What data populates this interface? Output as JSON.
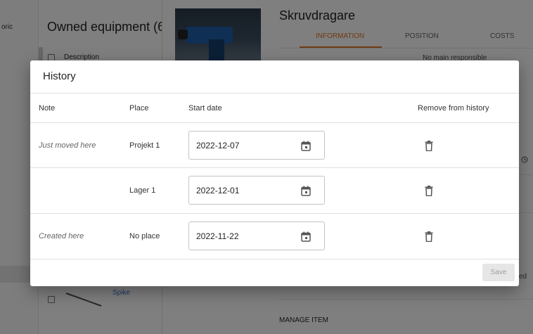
{
  "background": {
    "nav_fragment": "oric",
    "list_title": "Owned equipment (6",
    "list_header_description": "Description",
    "list_row_link": "Spike",
    "item_title": "Skruvdragare",
    "tabs": [
      {
        "label": "INFORMATION",
        "active": true
      },
      {
        "label": "POSITION",
        "active": false
      },
      {
        "label": "COSTS",
        "active": false
      }
    ],
    "responsible_text": "No main responsible",
    "edge_text": "ed",
    "section_manage": "MANAGE ITEM"
  },
  "dialog": {
    "title": "History",
    "columns": {
      "note": "Note",
      "place": "Place",
      "start_date": "Start date",
      "remove": "Remove from history"
    },
    "rows": [
      {
        "note": "Just moved here",
        "place": "Projekt 1",
        "start_date": "2022-12-07"
      },
      {
        "note": "",
        "place": "Lager 1",
        "start_date": "2022-12-01"
      },
      {
        "note": "Created here",
        "place": "No place",
        "start_date": "2022-11-22"
      }
    ],
    "save_label": "Save"
  },
  "icons": {
    "calendar": "calendar-icon",
    "delete": "trash-icon",
    "history": "history-icon"
  },
  "colors": {
    "accent": "#e0742a",
    "link": "#3a6fd0",
    "scrim": "rgba(0,0,0,0.5)"
  }
}
